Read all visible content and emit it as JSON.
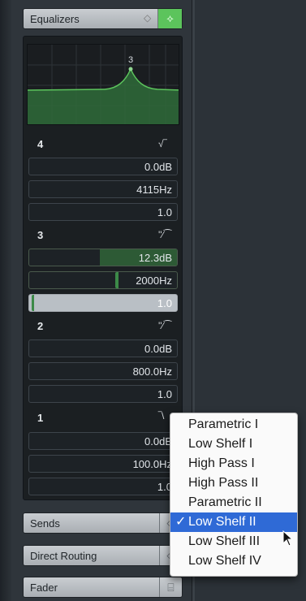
{
  "sections": {
    "equalizers": {
      "label": "Equalizers",
      "icon_a": "◇",
      "icon_b": "⟡"
    },
    "sends": {
      "label": "Sends"
    },
    "direct_routing": {
      "label": "Direct Routing"
    },
    "fader": {
      "label": "Fader"
    }
  },
  "graph": {
    "band_marker": "3"
  },
  "bands": [
    {
      "num": "4",
      "shape": "√‾",
      "gain": "0.0dB",
      "freq": "4115Hz",
      "q": "1.0"
    },
    {
      "num": "3",
      "shape": "''⁄⁀",
      "gain": "12.3dB",
      "freq": "2000Hz",
      "q": "1.0"
    },
    {
      "num": "2",
      "shape": "''⁄⁀",
      "gain": "0.0dB",
      "freq": "800.0Hz",
      "q": "1.0"
    },
    {
      "num": "1",
      "shape": "‾\\",
      "gain": "0.0dB",
      "freq": "100.0Hz",
      "q": "1.0"
    }
  ],
  "band3_gain_fill": 0.52,
  "dropdown": {
    "items": [
      "Parametric I",
      "Low Shelf I",
      "High Pass I",
      "High Pass II",
      "Parametric II",
      "Low Shelf II",
      "Low Shelf III",
      "Low Shelf IV"
    ],
    "selected_index": 5,
    "check": "✓"
  },
  "colors": {
    "accent_green": "#5cc45c",
    "selection_blue": "#2f6ad6"
  }
}
